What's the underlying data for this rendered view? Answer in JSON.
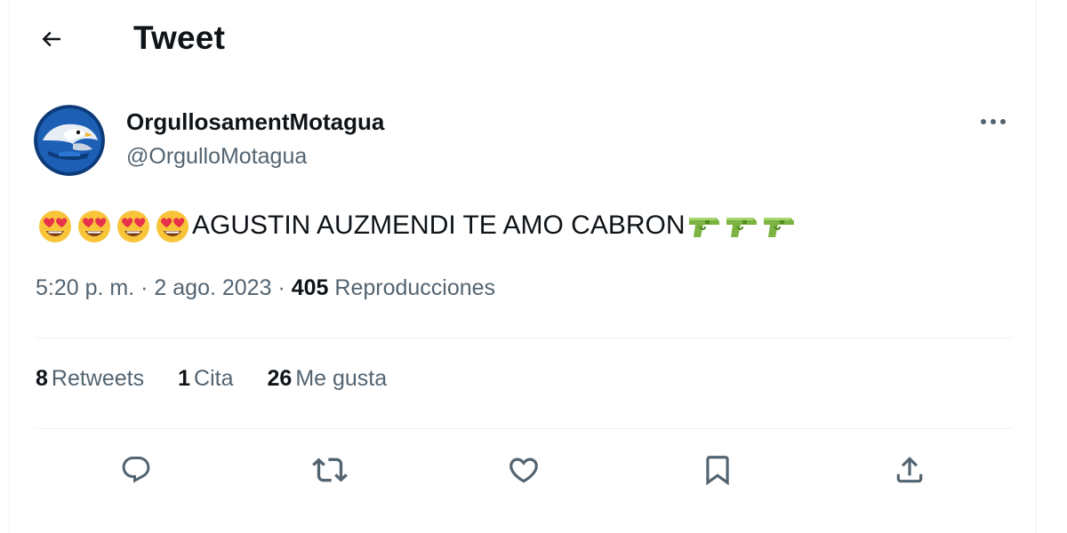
{
  "header": {
    "title": "Tweet"
  },
  "author": {
    "display_name": "OrgullosamentMotagua",
    "handle": "@OrgulloMotagua"
  },
  "tweet": {
    "text": "AGUSTIN AUZMENDI TE AMO CABRON",
    "leading_emoji": "heart-eyes-emoji",
    "leading_emoji_count": 4,
    "trailing_emoji": "water-pistol-emoji",
    "trailing_emoji_count": 3
  },
  "meta": {
    "time": "5:20 p. m.",
    "separator": "·",
    "date": "2 ago. 2023",
    "views_count": "405",
    "views_label": "Reproducciones"
  },
  "stats": {
    "retweets_count": "8",
    "retweets_label": "Retweets",
    "quotes_count": "1",
    "quotes_label": "Cita",
    "likes_count": "26",
    "likes_label": "Me gusta"
  },
  "actions": {
    "reply_icon": "reply-icon",
    "retweet_icon": "retweet-icon",
    "like_icon": "heart-icon",
    "bookmark_icon": "bookmark-icon",
    "share_icon": "share-icon"
  },
  "colors": {
    "text_primary": "#0f1419",
    "text_secondary": "#536471",
    "divider": "#eff3f4",
    "emoji_face": "#f8c53a",
    "emoji_heart": "#e8314a",
    "water_pistol": "#7cb342"
  }
}
